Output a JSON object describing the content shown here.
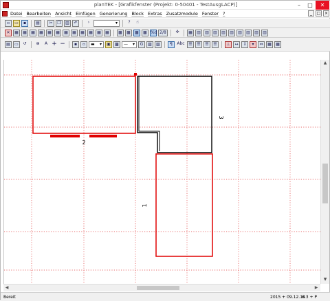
{
  "window": {
    "title": "planTEK - [Grafikfenster (Projekt: 0-50401 - TestAusgLACP)]",
    "controls": [
      "–",
      "□",
      "✕"
    ]
  },
  "menu": {
    "items": [
      "Datei",
      "Bearbeiten",
      "Ansicht",
      "Einfügen",
      "Generierung",
      "Block",
      "Extras",
      "Zusatzmodule",
      "Fenster",
      "?"
    ],
    "mdi_controls": [
      "_",
      "□",
      "×"
    ]
  },
  "toolbar1": {
    "icons": [
      "new-file-icon",
      "open-folder-icon",
      "save-icon",
      "print-icon",
      "cut-icon",
      "copy-icon",
      "paste-icon",
      "undo-icon",
      "arrow-right-icon",
      "help-icon",
      "hand-icon"
    ],
    "combo_value": ""
  },
  "toolbar2": {
    "icons": [
      "delete-icon",
      "module-icon",
      "module-icon",
      "module-icon",
      "module-icon",
      "module-icon",
      "module-icon",
      "module-icon",
      "module-icon",
      "module-icon",
      "module-icon",
      "module-icon",
      "module-icon",
      "grid-icon",
      "grid-icon",
      "grid-icon",
      "grid-icon",
      "grid-icon",
      "tool-icon",
      "tool-icon",
      "tool-icon",
      "tool-icon"
    ],
    "text_buttons": [
      "%d",
      "2/8",
      "Abc"
    ]
  },
  "toolbar3": {
    "icons": [
      "print-icon",
      "layer-icon",
      "rotate-icon",
      "zoom-icon",
      "arrow-icon",
      "plus-icon",
      "minus-icon"
    ],
    "text_buttons": [
      "A",
      "Abc"
    ]
  },
  "drawing": {
    "labels": [
      "2",
      "3",
      "1"
    ],
    "colors": {
      "selected": "#e00000",
      "normal": "#000000",
      "grid": "#e03030"
    }
  },
  "statusbar": {
    "left": "Bereit",
    "date": "2015 + 09.12.14",
    "mode": "6.3 + P"
  }
}
